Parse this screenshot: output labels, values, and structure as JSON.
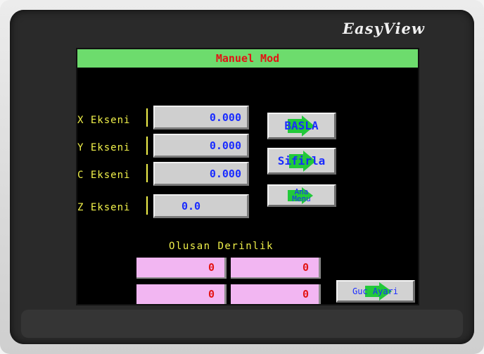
{
  "device": {
    "brand": "EasyView"
  },
  "screen": {
    "title": "Manuel Mod",
    "axes": [
      {
        "label": "X Ekseni",
        "value": "0.000"
      },
      {
        "label": "Y Ekseni",
        "value": "0.000"
      },
      {
        "label": "C Ekseni",
        "value": "0.000"
      },
      {
        "label": "Z Ekseni",
        "value": "0.0"
      }
    ],
    "buttons": {
      "start": "BASLA",
      "reset": "Sifirla",
      "main_menu_line1": "Ana",
      "main_menu_line2": "Menu",
      "power": "Guc Ayari"
    },
    "depth": {
      "label": "Olusan Derinlik",
      "values": [
        "0",
        "0",
        "0",
        "0"
      ]
    },
    "colors": {
      "title_bar": "#6ddc6d",
      "title_text": "#e31414",
      "label_text": "#f1f14a",
      "value_text": "#1a2cff",
      "depth_box": "#f2b6f2"
    },
    "icons": [
      "green-arrow-icon"
    ]
  }
}
